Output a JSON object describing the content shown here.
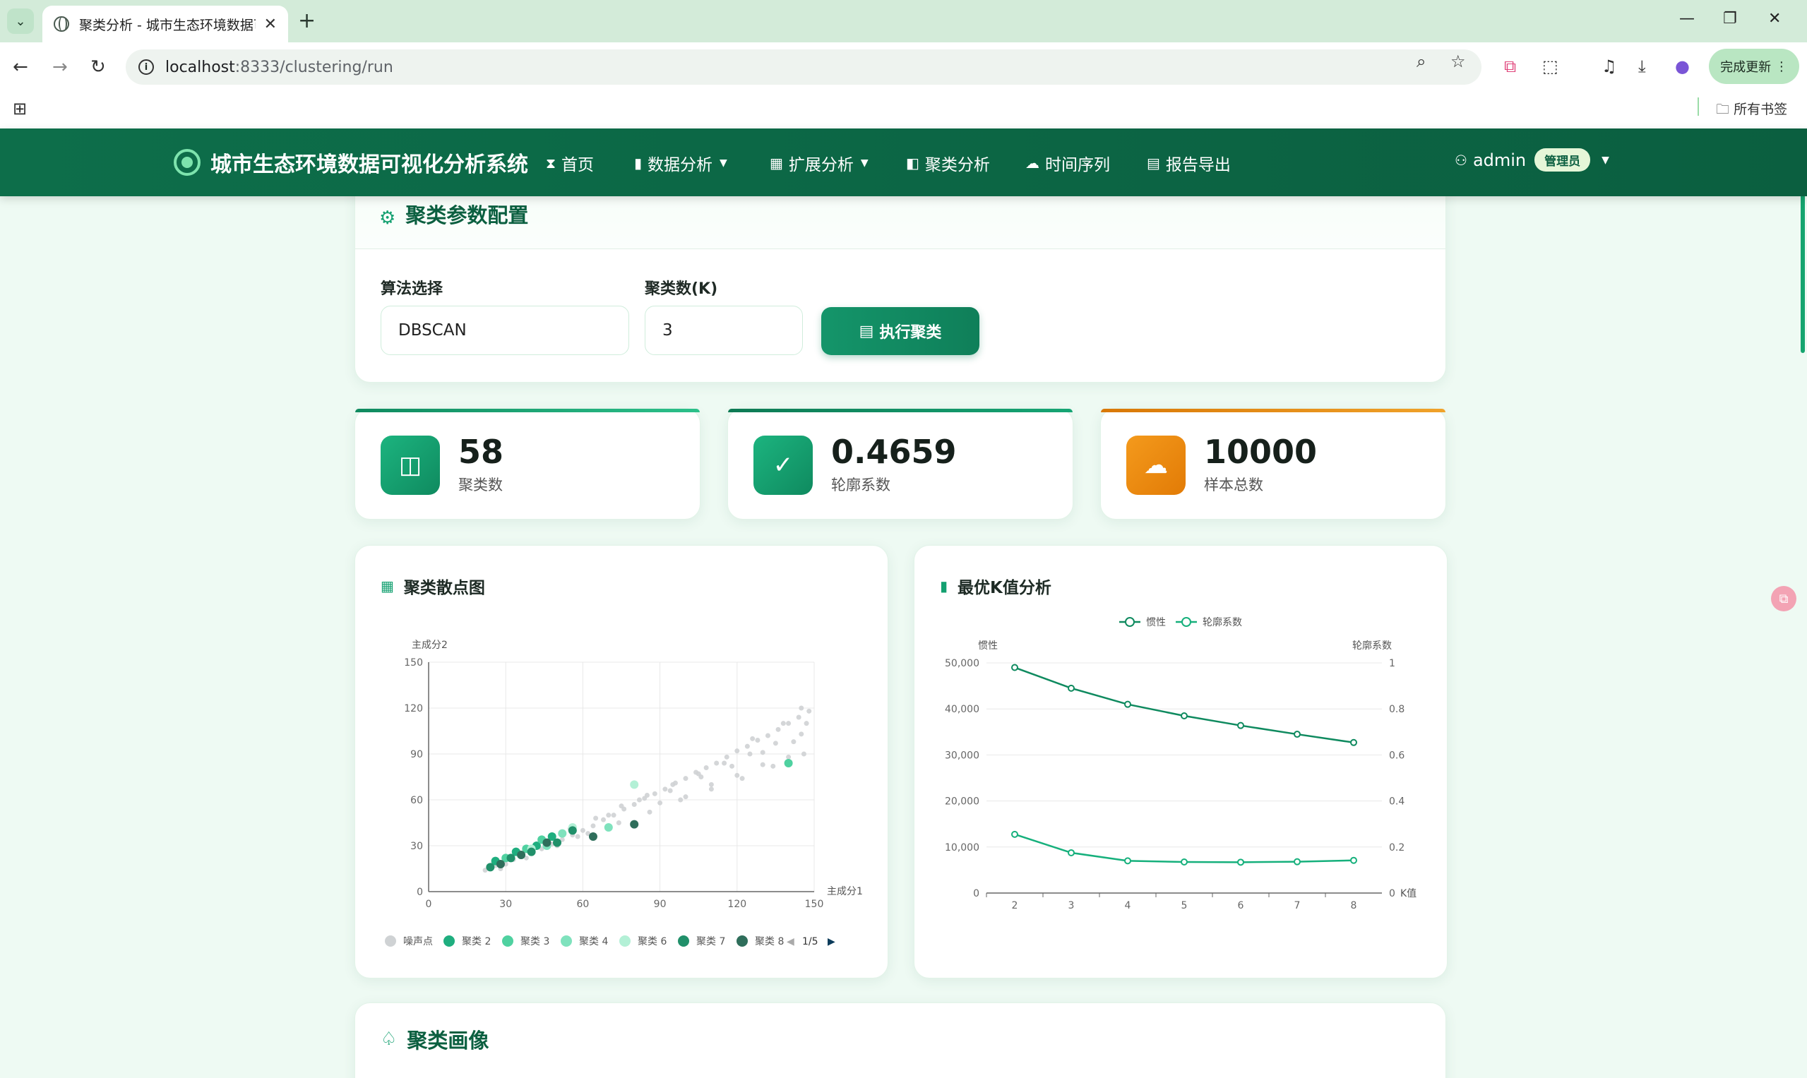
{
  "browser": {
    "tab_title": "聚类分析 - 城市生态环境数据可",
    "url_host": "localhost",
    "url_rest": ":8333/clustering/run",
    "update_label": "完成更新",
    "bookmarks_label": "所有书签"
  },
  "nav": {
    "brand": "城市生态环境数据可视化分析系统",
    "items": [
      {
        "label": "首页",
        "icon": "hourglass-icon"
      },
      {
        "label": "数据分析",
        "icon": "bar-chart-icon"
      },
      {
        "label": "扩展分析",
        "icon": "grid-icon"
      },
      {
        "label": "聚类分析",
        "icon": "panel-icon"
      },
      {
        "label": "时间序列",
        "icon": "cloud-icon"
      },
      {
        "label": "报告导出",
        "icon": "file-icon"
      }
    ],
    "user": "admin",
    "role": "管理员"
  },
  "config": {
    "title": "聚类参数配置",
    "algorithm_label": "算法选择",
    "algorithm_value": "DBSCAN",
    "k_label": "聚类数(K)",
    "k_value": "3",
    "run_label": "执行聚类"
  },
  "stats": [
    {
      "value": "58",
      "label": "聚类数",
      "color": "#14a271"
    },
    {
      "value": "0.4659",
      "label": "轮廓系数",
      "color": "#14a271"
    },
    {
      "value": "10000",
      "label": "样本总数",
      "color": "#e9850f"
    }
  ],
  "scatter": {
    "title": "聚类散点图",
    "legend_page": "1/5"
  },
  "kchart": {
    "title": "最优K值分析"
  },
  "portrait": {
    "title": "聚类画像"
  },
  "chart_data": [
    {
      "type": "scatter",
      "xlabel": "主成分1",
      "ylabel": "主成分2",
      "xlim": [
        0,
        150
      ],
      "ylim": [
        0,
        150
      ],
      "xticks": [
        0,
        30,
        60,
        90,
        120,
        150
      ],
      "yticks": [
        0,
        30,
        60,
        90,
        120,
        150
      ],
      "legend": [
        "噪声点",
        "聚类 2",
        "聚类 3",
        "聚类 4",
        "聚类 6",
        "聚类 7",
        "聚类 8"
      ],
      "legend_colors": [
        "#cfd2d4",
        "#1fae7f",
        "#4fd1a0",
        "#7fe2bd",
        "#b3f0d6",
        "#21906a",
        "#2f6e5b"
      ],
      "series": [
        {
          "name": "噪声点",
          "x": [
            22,
            26,
            30,
            33,
            36,
            40,
            44,
            48,
            52,
            56,
            60,
            64,
            68,
            72,
            76,
            80,
            84,
            88,
            92,
            96,
            100,
            104,
            108,
            112,
            116,
            120,
            124,
            128,
            132,
            136,
            140,
            144,
            148,
            25,
            35,
            45,
            55,
            65,
            75,
            85,
            95,
            105,
            115,
            125,
            135,
            145,
            28,
            38,
            50,
            62,
            74,
            86,
            98,
            110,
            122,
            134,
            146,
            42,
            58,
            70,
            82,
            94,
            106,
            118,
            130,
            142,
            90,
            100,
            110,
            120,
            130,
            140,
            145,
            147,
            138,
            126
          ],
          "y": [
            14,
            17,
            18,
            21,
            23,
            26,
            28,
            31,
            34,
            37,
            40,
            43,
            47,
            50,
            54,
            57,
            61,
            64,
            67,
            71,
            74,
            78,
            81,
            84,
            88,
            92,
            95,
            99,
            102,
            106,
            110,
            114,
            118,
            18,
            26,
            32,
            41,
            48,
            56,
            63,
            70,
            77,
            84,
            90,
            97,
            103,
            15,
            22,
            30,
            38,
            45,
            52,
            60,
            67,
            74,
            82,
            90,
            30,
            36,
            50,
            60,
            66,
            75,
            82,
            91,
            98,
            58,
            62,
            70,
            76,
            83,
            88,
            120,
            110,
            110,
            100
          ]
        },
        {
          "name": "聚类 2",
          "x": [
            26,
            34,
            42,
            48
          ],
          "y": [
            20,
            26,
            30,
            36
          ]
        },
        {
          "name": "聚类 3",
          "x": [
            30,
            38,
            44,
            140
          ],
          "y": [
            22,
            28,
            34,
            84
          ]
        },
        {
          "name": "聚类 4",
          "x": [
            36,
            46,
            52,
            70
          ],
          "y": [
            24,
            30,
            38,
            42
          ]
        },
        {
          "name": "聚类 6",
          "x": [
            40,
            56,
            80
          ],
          "y": [
            28,
            42,
            70
          ]
        },
        {
          "name": "聚类 7",
          "x": [
            24,
            32,
            40,
            50,
            56
          ],
          "y": [
            16,
            22,
            26,
            32,
            40
          ]
        },
        {
          "name": "聚类 8",
          "x": [
            28,
            36,
            46,
            64,
            80
          ],
          "y": [
            18,
            24,
            32,
            36,
            44
          ]
        }
      ]
    },
    {
      "type": "line",
      "x": [
        2,
        3,
        4,
        5,
        6,
        7,
        8
      ],
      "xlabel": "K值",
      "ylabel_left": "惯性",
      "ylabel_right": "轮廓系数",
      "ylim_left": [
        0,
        50000
      ],
      "ylim_right": [
        0,
        1
      ],
      "yticks_left": [
        "0",
        "10,000",
        "20,000",
        "30,000",
        "40,000",
        "50,000"
      ],
      "yticks_right": [
        "0",
        "0.2",
        "0.4",
        "0.6",
        "0.8",
        "1"
      ],
      "legend": [
        "惯性",
        "轮廓系数"
      ],
      "series": [
        {
          "name": "惯性",
          "axis": "left",
          "values": [
            49000,
            44500,
            41000,
            38500,
            36400,
            34500,
            32700
          ],
          "color": "#0f8a5f"
        },
        {
          "name": "轮廓系数",
          "axis": "right",
          "values": [
            0.255,
            0.175,
            0.14,
            0.135,
            0.134,
            0.136,
            0.142
          ],
          "color": "#16b07c"
        }
      ]
    }
  ]
}
